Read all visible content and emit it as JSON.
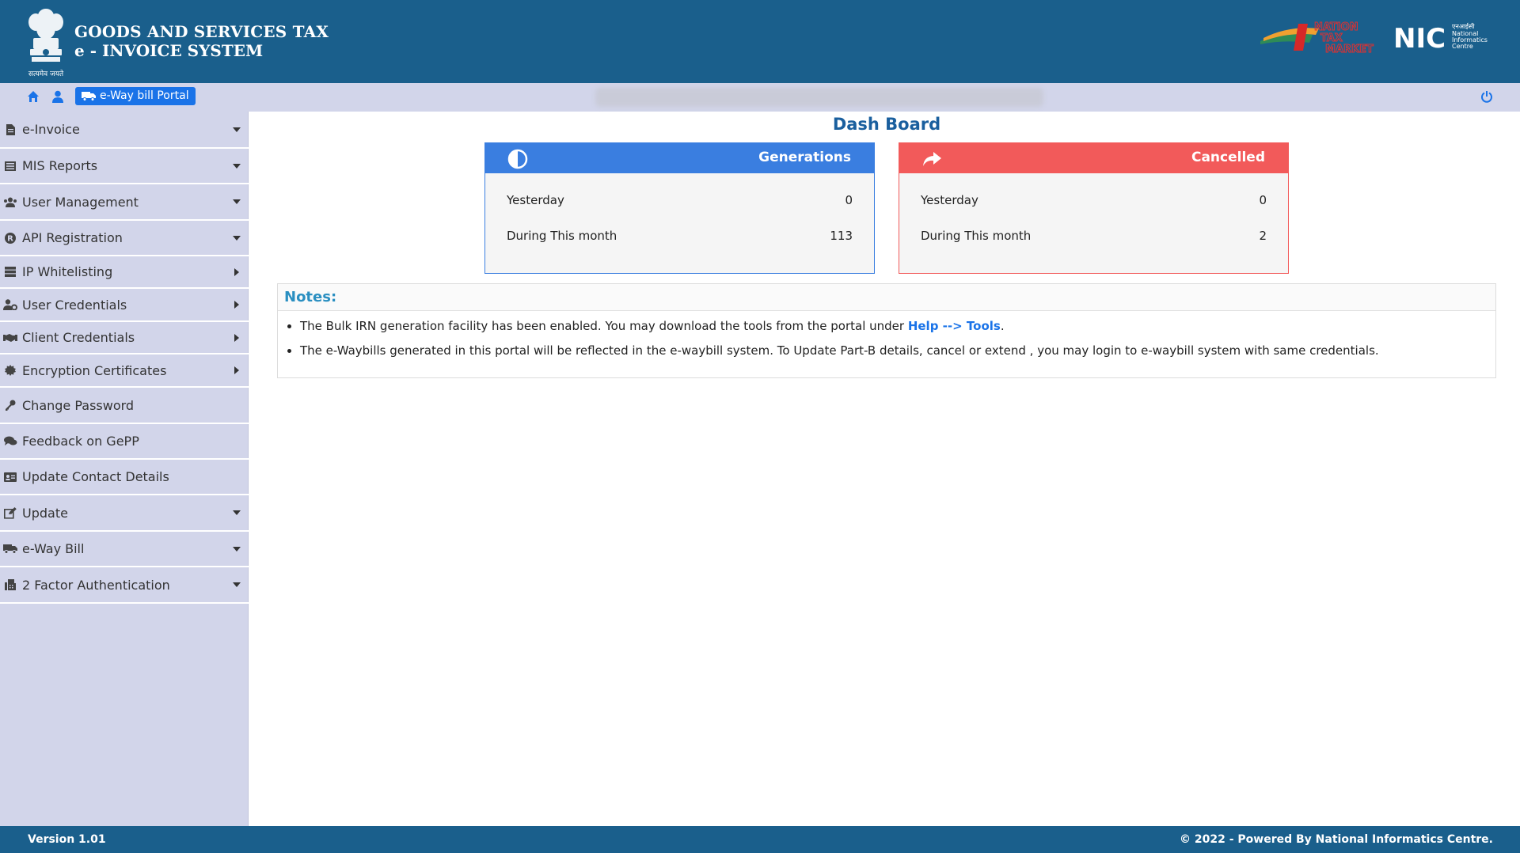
{
  "header": {
    "title_line1": "GOODS AND SERVICES TAX",
    "title_line2": "e - INVOICE SYSTEM",
    "emblem_caption": "सत्यमेव जयते",
    "ntm_logo_text": [
      "NATION",
      "TAX",
      "MARKET"
    ],
    "nic_logo_text": "NIC",
    "nic_logo_sub": [
      "एनआईसी",
      "National",
      "Informatics",
      "Centre"
    ]
  },
  "toolbar": {
    "eway_button_label": "e-Way bill Portal",
    "blurred_info": "",
    "icons": [
      "home-icon",
      "user-icon",
      "truck-icon",
      "power-icon"
    ]
  },
  "sidebar": {
    "items": [
      {
        "label": "e-Invoice",
        "icon": "document-icon",
        "caret": "down"
      },
      {
        "label": "MIS Reports",
        "icon": "list-icon",
        "caret": "down"
      },
      {
        "label": "User Management",
        "icon": "users-icon",
        "caret": "down"
      },
      {
        "label": "API Registration",
        "icon": "registered-icon",
        "caret": "down"
      },
      {
        "label": "IP Whitelisting",
        "icon": "server-icon",
        "caret": "right"
      },
      {
        "label": "User Credentials",
        "icon": "user-cog-icon",
        "caret": "right"
      },
      {
        "label": "Client Credentials",
        "icon": "handshake-icon",
        "caret": "right"
      },
      {
        "label": "Encryption Certificates",
        "icon": "certificate-icon",
        "caret": "right"
      },
      {
        "label": "Change Password",
        "icon": "key-icon",
        "caret": ""
      },
      {
        "label": "Feedback on GePP",
        "icon": "comments-icon",
        "caret": ""
      },
      {
        "label": "Update Contact Details",
        "icon": "id-card-icon",
        "caret": ""
      },
      {
        "label": "Update",
        "icon": "edit-icon",
        "caret": "down"
      },
      {
        "label": "e-Way Bill",
        "icon": "truck-icon",
        "caret": "down"
      },
      {
        "label": "2 Factor Authentication",
        "icon": "fax-icon",
        "caret": "down"
      }
    ]
  },
  "dashboard": {
    "title": "Dash Board",
    "generations": {
      "title": "Generations",
      "icon": "adjust-icon",
      "color": "#3a7ee0",
      "rows": [
        {
          "label": "Yesterday",
          "value": "0"
        },
        {
          "label": "During This month",
          "value": "113"
        }
      ]
    },
    "cancelled": {
      "title": "Cancelled",
      "icon": "share-icon",
      "color": "#f25a5a",
      "rows": [
        {
          "label": "Yesterday",
          "value": "0"
        },
        {
          "label": "During This month",
          "value": "2"
        }
      ]
    }
  },
  "notes": {
    "heading": "Notes:",
    "note1_prefix": "The Bulk IRN generation facility has been enabled. You may download the tools from the portal under ",
    "note1_link": "Help --> Tools",
    "note1_suffix": ".",
    "note2": "The e-Waybills generated in this portal will be reflected in the e-waybill system. To Update Part-B details, cancel or extend , you may login to e-waybill system with same credentials."
  },
  "footer": {
    "version": "Version 1.01",
    "copyright": "© 2022 - Powered By National Informatics Centre."
  }
}
